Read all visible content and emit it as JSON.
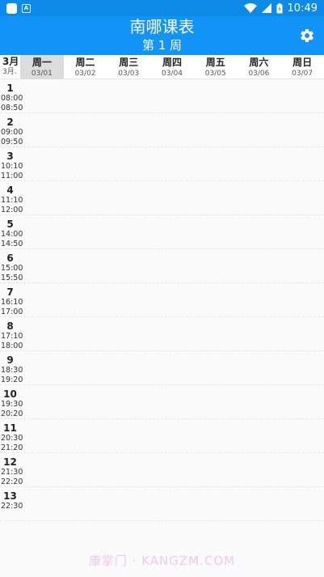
{
  "status_bar": {
    "time": "10:49",
    "app_icon_letter": "A"
  },
  "app_bar": {
    "title": "南哪课表",
    "subtitle": "第 1 周"
  },
  "header": {
    "month": "3月",
    "month_sub": "3月."
  },
  "days": [
    {
      "name": "周一",
      "date": "03/01"
    },
    {
      "name": "周二",
      "date": "03/02"
    },
    {
      "name": "周三",
      "date": "03/03"
    },
    {
      "name": "周四",
      "date": "03/04"
    },
    {
      "name": "周五",
      "date": "03/05"
    },
    {
      "name": "周六",
      "date": "03/06"
    },
    {
      "name": "周日",
      "date": "03/07"
    }
  ],
  "periods": [
    {
      "num": "1",
      "start": "08:00",
      "end": "08:50"
    },
    {
      "num": "2",
      "start": "09:00",
      "end": "09:50"
    },
    {
      "num": "3",
      "start": "10:10",
      "end": "11:00"
    },
    {
      "num": "4",
      "start": "11:10",
      "end": "12:00"
    },
    {
      "num": "5",
      "start": "14:00",
      "end": "14:50"
    },
    {
      "num": "6",
      "start": "15:00",
      "end": "15:50"
    },
    {
      "num": "7",
      "start": "16:10",
      "end": "17:00"
    },
    {
      "num": "8",
      "start": "17:10",
      "end": "18:00"
    },
    {
      "num": "9",
      "start": "18:30",
      "end": "19:20"
    },
    {
      "num": "10",
      "start": "19:30",
      "end": "20:20"
    },
    {
      "num": "11",
      "start": "20:30",
      "end": "21:20"
    },
    {
      "num": "12",
      "start": "21:30",
      "end": "22:20"
    },
    {
      "num": "13",
      "start": "22:30",
      "end": ""
    }
  ],
  "watermark": "康掌门 · KANGZM.COM",
  "colors": {
    "app_bar": "#1194f6",
    "status_bar": "#0d8ae8",
    "today_highlight": "#dcdcdc"
  }
}
